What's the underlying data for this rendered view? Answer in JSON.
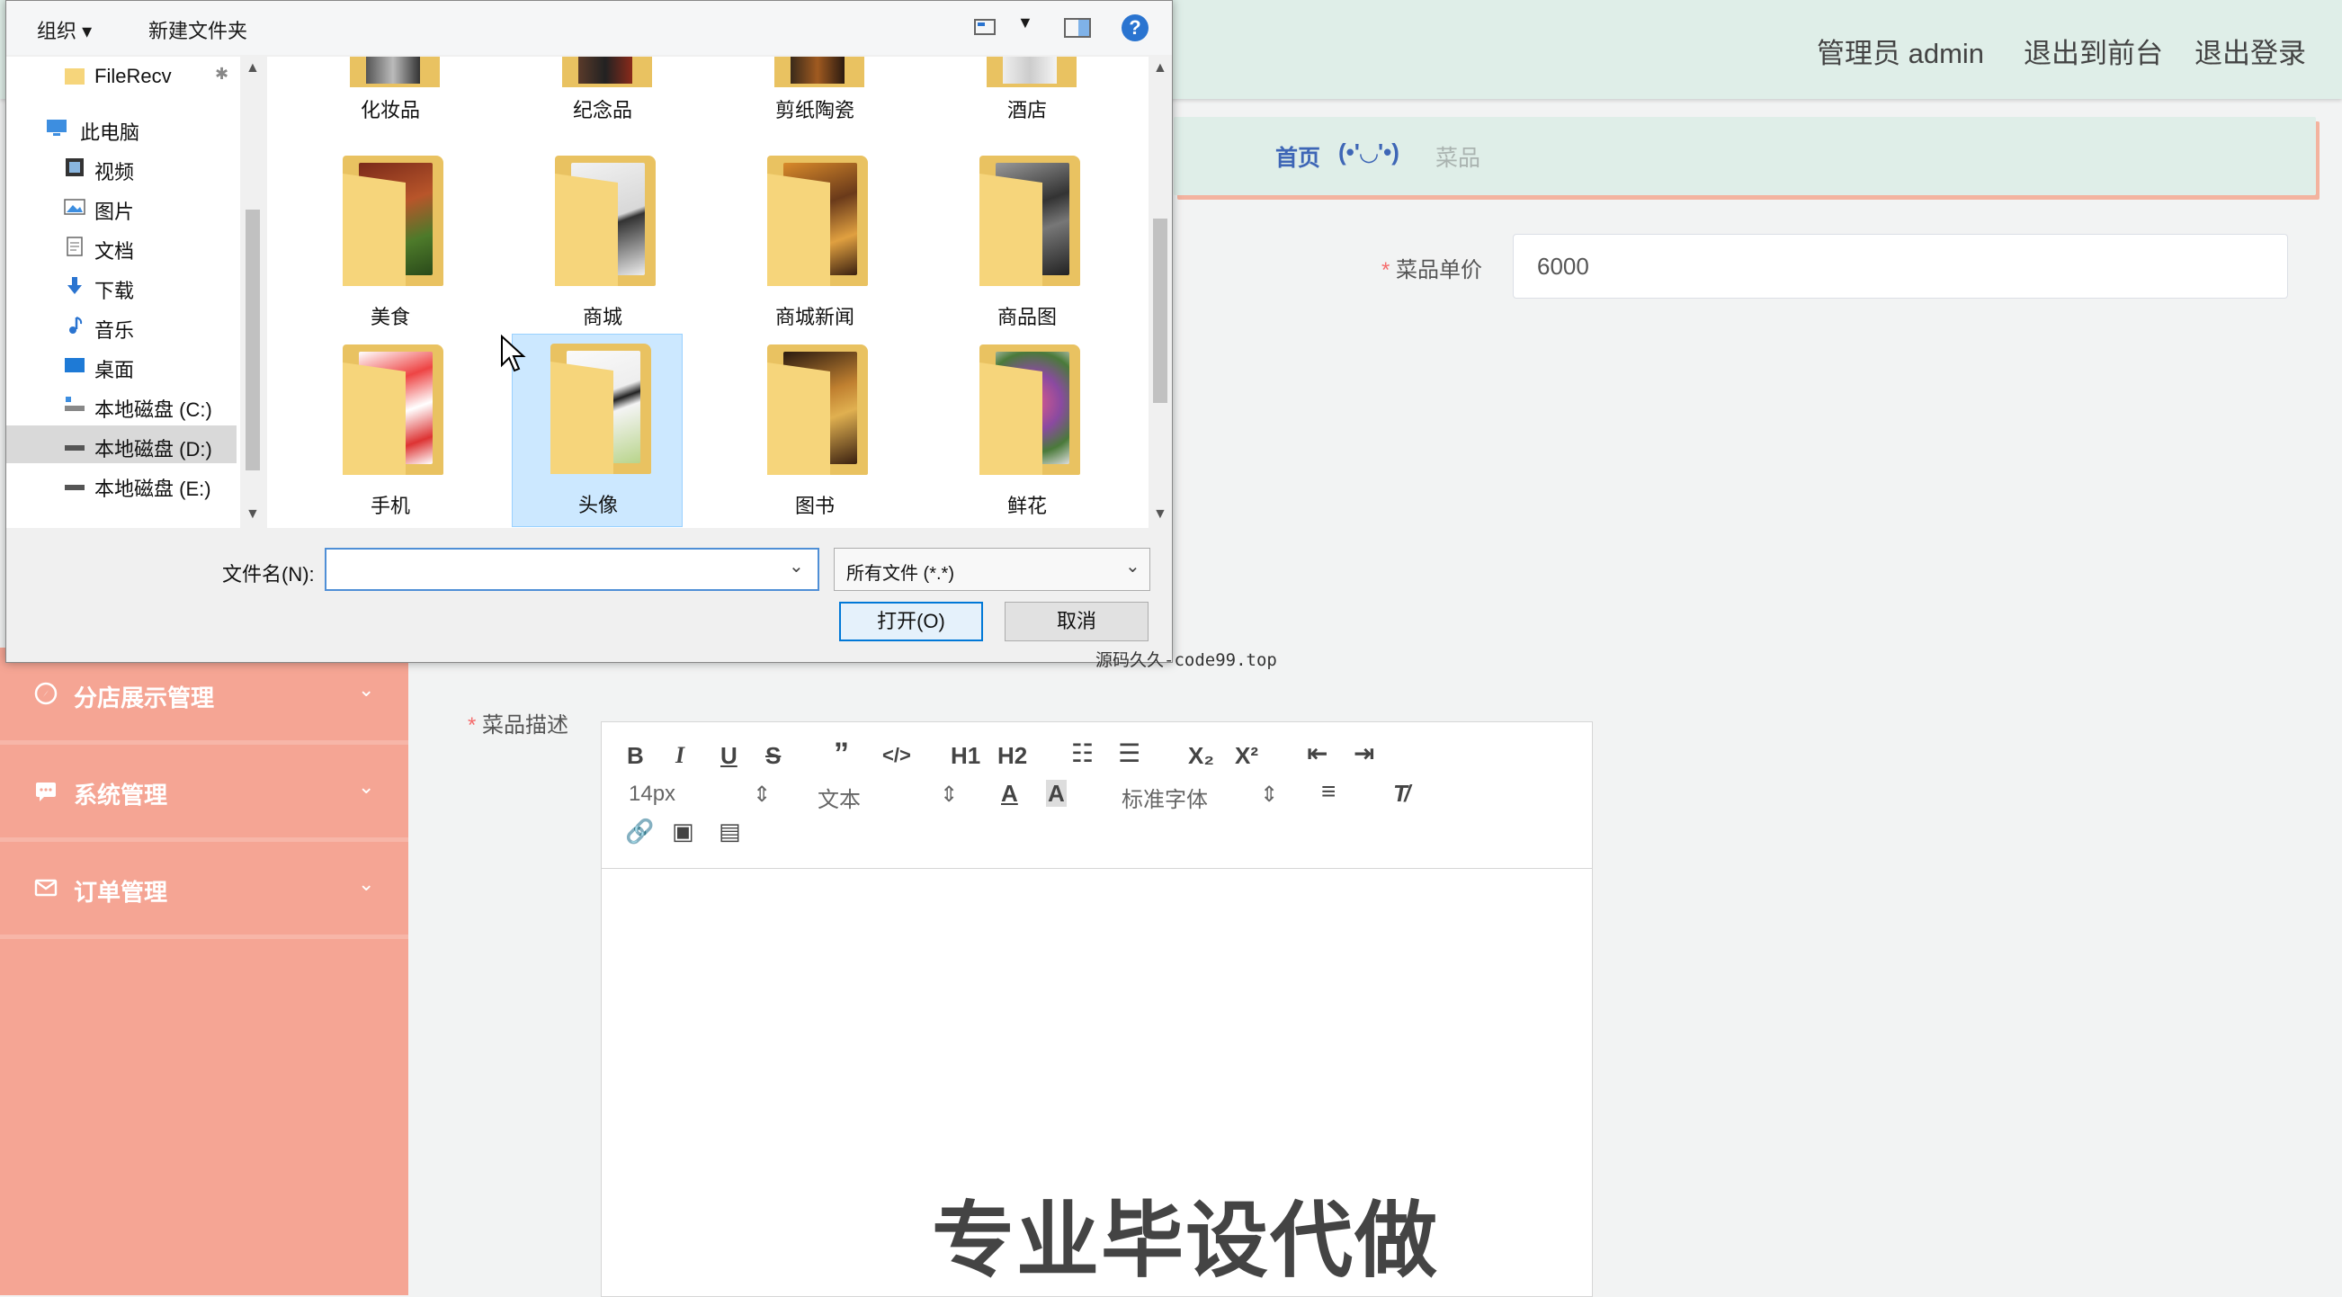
{
  "header": {
    "admin_label": "管理员 admin",
    "to_front": "退出到前台",
    "logout": "退出登录"
  },
  "breadcrumb": {
    "home": "首页",
    "face": "(•'◡'•)",
    "current": "菜品"
  },
  "form": {
    "price_label": "菜品单价",
    "price_value": "6000",
    "desc_label": "菜品描述",
    "required_mark": "*"
  },
  "sidebar": {
    "items": [
      {
        "label": "分店展示管理",
        "icon": "compass-icon"
      },
      {
        "label": "系统管理",
        "icon": "chat-icon"
      },
      {
        "label": "订单管理",
        "icon": "mail-icon"
      }
    ]
  },
  "editor": {
    "font_size": "14px",
    "format": "文本",
    "font_family": "标准字体",
    "h1": "H1",
    "h2": "H2",
    "sub": "X₂",
    "sup": "X²"
  },
  "watermark": {
    "big": "专业毕设代做",
    "small": "源码久久-code99.top"
  },
  "dialog": {
    "toolbar": {
      "organize": "组织 ▾",
      "new_folder": "新建文件夹"
    },
    "nav": [
      {
        "label": "FileRecv",
        "icon": "folder-icon"
      },
      {
        "label": "此电脑",
        "icon": "computer-icon"
      },
      {
        "label": "视频",
        "icon": "video-icon"
      },
      {
        "label": "图片",
        "icon": "picture-icon"
      },
      {
        "label": "文档",
        "icon": "document-icon"
      },
      {
        "label": "下载",
        "icon": "download-icon"
      },
      {
        "label": "音乐",
        "icon": "music-icon"
      },
      {
        "label": "桌面",
        "icon": "desktop-icon"
      },
      {
        "label": "本地磁盘 (C:)",
        "icon": "drive-icon"
      },
      {
        "label": "本地磁盘 (D:)",
        "icon": "drive-icon"
      },
      {
        "label": "本地磁盘 (E:)",
        "icon": "drive-icon"
      }
    ],
    "top_folders": [
      "化妆品",
      "纪念品",
      "剪纸陶瓷",
      "酒店"
    ],
    "folders_row1": [
      "美食",
      "商城",
      "商城新闻",
      "商品图"
    ],
    "folders_row2": [
      "手机",
      "头像",
      "图书",
      "鲜花"
    ],
    "selected_folder": "头像",
    "filename_label": "文件名(N):",
    "filename_value": "",
    "filetype": "所有文件 (*.*)",
    "open_button": "打开(O)",
    "cancel_button": "取消",
    "help": "?"
  }
}
